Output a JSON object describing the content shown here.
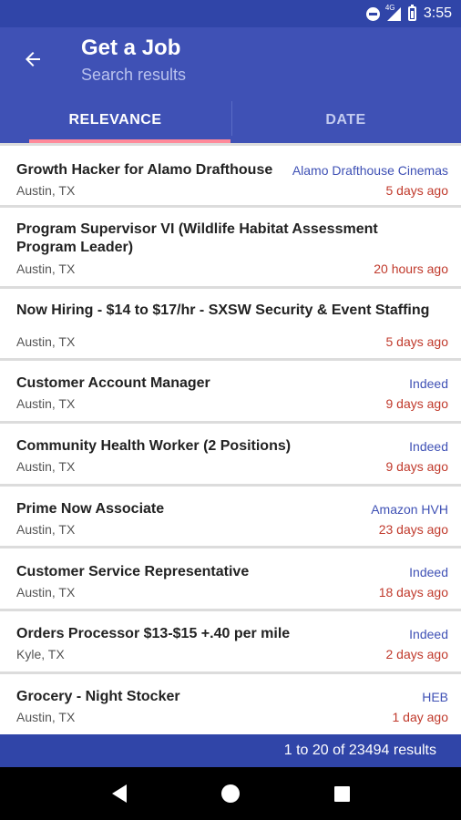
{
  "status_bar": {
    "network": "4G",
    "time": "3:55"
  },
  "app_bar": {
    "title": "Get a Job",
    "subtitle": "Search results"
  },
  "tabs": [
    {
      "label": "RELEVANCE",
      "active": true
    },
    {
      "label": "DATE",
      "active": false
    }
  ],
  "jobs": [
    {
      "title": "Growth Hacker for Alamo Drafthouse",
      "company": "Alamo Drafthouse Cinemas",
      "location": "Austin, TX",
      "age": "5 days ago"
    },
    {
      "title": "Program Supervisor VI (Wildlife Habitat Assessment Program Leader)",
      "company": "",
      "location": "Austin, TX",
      "age": "20 hours ago"
    },
    {
      "title": "Now Hiring - $14 to $17/hr - SXSW Security & Event Staffing",
      "company": "",
      "location": "Austin, TX",
      "age": "5 days ago"
    },
    {
      "title": "Customer Account Manager",
      "company": "Indeed",
      "location": "Austin, TX",
      "age": "9 days ago"
    },
    {
      "title": "Community Health Worker (2 Positions)",
      "company": "Indeed",
      "location": "Austin, TX",
      "age": "9 days ago"
    },
    {
      "title": "Prime Now Associate",
      "company": "Amazon HVH",
      "location": "Austin, TX",
      "age": "23 days ago"
    },
    {
      "title": "Customer Service Representative",
      "company": "Indeed",
      "location": "Austin, TX",
      "age": "18 days ago"
    },
    {
      "title": "Orders Processor $13-$15 +.40 per mile",
      "company": "Indeed",
      "location": "Kyle, TX",
      "age": "2 days ago"
    },
    {
      "title": "Grocery - Night Stocker",
      "company": "HEB",
      "location": "Austin, TX",
      "age": "1 day ago"
    }
  ],
  "footer": {
    "results_text": "1 to 20 of 23494 results"
  },
  "colors": {
    "primary": "#3f51b5",
    "primary_dark": "#3045a8",
    "accent": "#ff8a9a",
    "age_red": "#c0392b"
  }
}
